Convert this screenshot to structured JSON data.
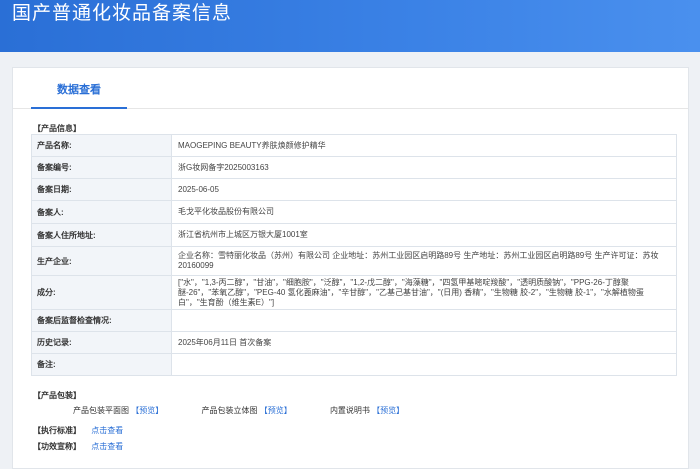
{
  "banner": {
    "title": "国产普通化妆品备案信息"
  },
  "tabs": [
    {
      "label": "数据查看"
    }
  ],
  "product_info": {
    "section_title": "【产品信息】",
    "rows": [
      {
        "label": "产品名称:",
        "value": "MAOGEPING BEAUTY养肤焕颜修护精华"
      },
      {
        "label": "备案编号:",
        "value": "浙G妆网备字2025003163"
      },
      {
        "label": "备案日期:",
        "value": "2025-06-05"
      },
      {
        "label": "备案人:",
        "value": "毛戈平化妆品股份有限公司"
      },
      {
        "label": "备案人住所地址:",
        "value": "浙江省杭州市上城区万银大厦1001室"
      },
      {
        "label": "生产企业:",
        "value": "企业名称：雪特丽化妆品（苏州）有限公司 企业地址：苏州工业园区启明路89号 生产地址：苏州工业园区启明路89号 生产许可证：苏妆20160099"
      },
      {
        "label": "成分:",
        "value": "[\"水\"，\"1,3-丙二醇\"，\"甘油\"，\"细胞胺\"，\"泛醇\"，\"1,2-戊二醇\"，\"海藻糖\"，\"四氢甲基嘧啶羧酸\"，\"透明质酸钠\"，\"PPG-26-丁醇聚醚-26\"，\"苯氧乙醇\"，\"PEG-40 氢化蓖麻油\"，\"辛甘醇\"，\"乙基己基甘油\"，\"(日用) 香精\"，\"生物糖 胶-2\"，\"生物糖 胶-1\"，\"水解植物蛋白\"，\"生育酚（维生素E）\"]"
      },
      {
        "label": "备案后监督检查情况:",
        "value": ""
      },
      {
        "label": "历史记录:",
        "value": "2025年06月11日 首次备案"
      },
      {
        "label": "备注:",
        "value": ""
      }
    ]
  },
  "packaging": {
    "section_title": "【产品包装】",
    "items": [
      {
        "label": "产品包装平面图",
        "link": "【预览】"
      },
      {
        "label": "产品包装立体图",
        "link": "【预览】"
      },
      {
        "label": "内置说明书",
        "link": "【预览】"
      }
    ]
  },
  "standards": {
    "label": "【执行标准】",
    "link": "点击查看"
  },
  "efficacy": {
    "label": "【功效宣称】",
    "link": "点击查看"
  },
  "colors": {
    "accent": "#2a6fd6",
    "label_bg": "#f2f5f9",
    "banner": "#3b82e6"
  }
}
